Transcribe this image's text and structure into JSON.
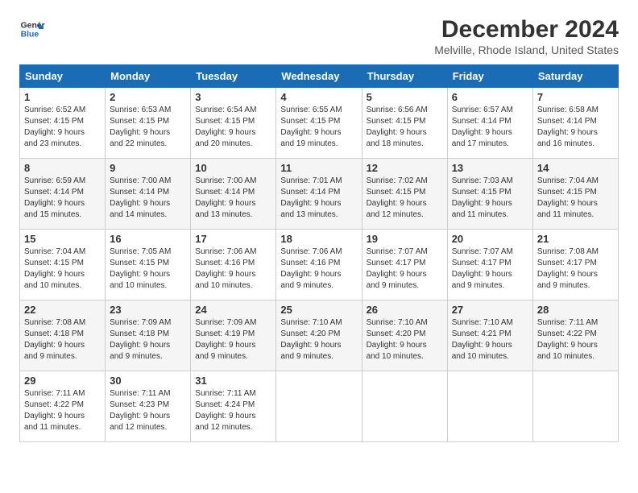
{
  "header": {
    "logo_line1": "General",
    "logo_line2": "Blue",
    "title": "December 2024",
    "subtitle": "Melville, Rhode Island, United States"
  },
  "days_of_week": [
    "Sunday",
    "Monday",
    "Tuesday",
    "Wednesday",
    "Thursday",
    "Friday",
    "Saturday"
  ],
  "weeks": [
    [
      {
        "num": "1",
        "info": "Sunrise: 6:52 AM\nSunset: 4:15 PM\nDaylight: 9 hours\nand 23 minutes."
      },
      {
        "num": "2",
        "info": "Sunrise: 6:53 AM\nSunset: 4:15 PM\nDaylight: 9 hours\nand 22 minutes."
      },
      {
        "num": "3",
        "info": "Sunrise: 6:54 AM\nSunset: 4:15 PM\nDaylight: 9 hours\nand 20 minutes."
      },
      {
        "num": "4",
        "info": "Sunrise: 6:55 AM\nSunset: 4:15 PM\nDaylight: 9 hours\nand 19 minutes."
      },
      {
        "num": "5",
        "info": "Sunrise: 6:56 AM\nSunset: 4:15 PM\nDaylight: 9 hours\nand 18 minutes."
      },
      {
        "num": "6",
        "info": "Sunrise: 6:57 AM\nSunset: 4:14 PM\nDaylight: 9 hours\nand 17 minutes."
      },
      {
        "num": "7",
        "info": "Sunrise: 6:58 AM\nSunset: 4:14 PM\nDaylight: 9 hours\nand 16 minutes."
      }
    ],
    [
      {
        "num": "8",
        "info": "Sunrise: 6:59 AM\nSunset: 4:14 PM\nDaylight: 9 hours\nand 15 minutes."
      },
      {
        "num": "9",
        "info": "Sunrise: 7:00 AM\nSunset: 4:14 PM\nDaylight: 9 hours\nand 14 minutes."
      },
      {
        "num": "10",
        "info": "Sunrise: 7:00 AM\nSunset: 4:14 PM\nDaylight: 9 hours\nand 13 minutes."
      },
      {
        "num": "11",
        "info": "Sunrise: 7:01 AM\nSunset: 4:14 PM\nDaylight: 9 hours\nand 13 minutes."
      },
      {
        "num": "12",
        "info": "Sunrise: 7:02 AM\nSunset: 4:15 PM\nDaylight: 9 hours\nand 12 minutes."
      },
      {
        "num": "13",
        "info": "Sunrise: 7:03 AM\nSunset: 4:15 PM\nDaylight: 9 hours\nand 11 minutes."
      },
      {
        "num": "14",
        "info": "Sunrise: 7:04 AM\nSunset: 4:15 PM\nDaylight: 9 hours\nand 11 minutes."
      }
    ],
    [
      {
        "num": "15",
        "info": "Sunrise: 7:04 AM\nSunset: 4:15 PM\nDaylight: 9 hours\nand 10 minutes."
      },
      {
        "num": "16",
        "info": "Sunrise: 7:05 AM\nSunset: 4:15 PM\nDaylight: 9 hours\nand 10 minutes."
      },
      {
        "num": "17",
        "info": "Sunrise: 7:06 AM\nSunset: 4:16 PM\nDaylight: 9 hours\nand 10 minutes."
      },
      {
        "num": "18",
        "info": "Sunrise: 7:06 AM\nSunset: 4:16 PM\nDaylight: 9 hours\nand 9 minutes."
      },
      {
        "num": "19",
        "info": "Sunrise: 7:07 AM\nSunset: 4:17 PM\nDaylight: 9 hours\nand 9 minutes."
      },
      {
        "num": "20",
        "info": "Sunrise: 7:07 AM\nSunset: 4:17 PM\nDaylight: 9 hours\nand 9 minutes."
      },
      {
        "num": "21",
        "info": "Sunrise: 7:08 AM\nSunset: 4:17 PM\nDaylight: 9 hours\nand 9 minutes."
      }
    ],
    [
      {
        "num": "22",
        "info": "Sunrise: 7:08 AM\nSunset: 4:18 PM\nDaylight: 9 hours\nand 9 minutes."
      },
      {
        "num": "23",
        "info": "Sunrise: 7:09 AM\nSunset: 4:18 PM\nDaylight: 9 hours\nand 9 minutes."
      },
      {
        "num": "24",
        "info": "Sunrise: 7:09 AM\nSunset: 4:19 PM\nDaylight: 9 hours\nand 9 minutes."
      },
      {
        "num": "25",
        "info": "Sunrise: 7:10 AM\nSunset: 4:20 PM\nDaylight: 9 hours\nand 9 minutes."
      },
      {
        "num": "26",
        "info": "Sunrise: 7:10 AM\nSunset: 4:20 PM\nDaylight: 9 hours\nand 10 minutes."
      },
      {
        "num": "27",
        "info": "Sunrise: 7:10 AM\nSunset: 4:21 PM\nDaylight: 9 hours\nand 10 minutes."
      },
      {
        "num": "28",
        "info": "Sunrise: 7:11 AM\nSunset: 4:22 PM\nDaylight: 9 hours\nand 10 minutes."
      }
    ],
    [
      {
        "num": "29",
        "info": "Sunrise: 7:11 AM\nSunset: 4:22 PM\nDaylight: 9 hours\nand 11 minutes."
      },
      {
        "num": "30",
        "info": "Sunrise: 7:11 AM\nSunset: 4:23 PM\nDaylight: 9 hours\nand 12 minutes."
      },
      {
        "num": "31",
        "info": "Sunrise: 7:11 AM\nSunset: 4:24 PM\nDaylight: 9 hours\nand 12 minutes."
      },
      null,
      null,
      null,
      null
    ]
  ]
}
